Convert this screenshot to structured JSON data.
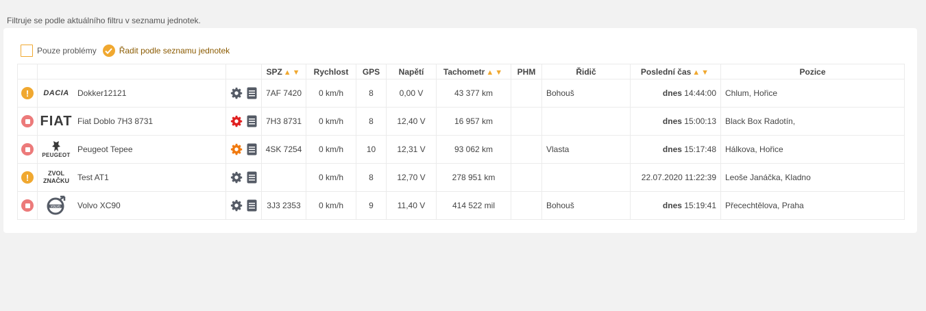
{
  "filter_note": "Filtruje se podle aktuálního filtru v seznamu jednotek.",
  "options": {
    "only_problems": "Pouze problémy",
    "sort_by_list": "Řadit podle seznamu jednotek"
  },
  "columns": {
    "spz": "SPZ",
    "speed": "Rychlost",
    "gps": "GPS",
    "voltage": "Napětí",
    "tachometer": "Tachometr",
    "phm": "PHM",
    "driver": "Řidič",
    "last_time": "Poslední čas",
    "position": "Pozice"
  },
  "colors": {
    "accent": "#f0a830",
    "stop": "#ec7a7a",
    "gear_default": "#555b66",
    "gear_red": "#e02020",
    "gear_orange": "#f07a10",
    "gps_green": "#2a8a2a"
  },
  "rows": [
    {
      "status": "warning-icon",
      "brand": "DACIA",
      "name": "Dokker12121",
      "gear": "default",
      "spz": "7AF 7420",
      "speed": "0 km/h",
      "gps": "8",
      "voltage": "0,00 V",
      "tachometer": "43 377 km",
      "phm": "",
      "driver": "Bohouš",
      "time_day": "dnes",
      "time": "14:44:00",
      "position": "Chlum, Hořice"
    },
    {
      "status": "stop-icon",
      "brand": "FIAT",
      "name": "Fiat Doblo 7H3 8731",
      "gear": "red",
      "spz": "7H3 8731",
      "speed": "0 km/h",
      "gps": "8",
      "voltage": "12,40 V",
      "tachometer": "16 957 km",
      "phm": "",
      "driver": "",
      "time_day": "dnes",
      "time": "15:00:13",
      "position": "Black Box Radotín,"
    },
    {
      "status": "stop-icon",
      "brand": "PEUGEOT",
      "name": "Peugeot Tepee",
      "gear": "orange",
      "spz": "4SK 7254",
      "speed": "0 km/h",
      "gps": "10",
      "voltage": "12,31 V",
      "tachometer": "93 062 km",
      "phm": "",
      "driver": "Vlasta",
      "time_day": "dnes",
      "time": "15:17:48",
      "position": "Hálkova, Hořice"
    },
    {
      "status": "warning-icon",
      "brand_line1": "ZVOL",
      "brand_line2": "ZNAČKU",
      "name": "Test AT1",
      "gear": "default",
      "spz": "",
      "speed": "0 km/h",
      "gps": "8",
      "voltage": "12,70 V",
      "tachometer": "278 951 km",
      "phm": "",
      "driver": "",
      "time_day": "",
      "time": "22.07.2020 11:22:39",
      "position": "Leoše Janáčka, Kladno"
    },
    {
      "status": "stop-icon",
      "brand": "VOLVO",
      "name": "Volvo XC90",
      "gear": "default",
      "spz": "3J3 2353",
      "speed": "0 km/h",
      "gps": "9",
      "voltage": "11,40 V",
      "tachometer": "414 522 mil",
      "phm": "",
      "driver": "Bohouš",
      "time_day": "dnes",
      "time": "15:19:41",
      "position": "Přecechtělova, Praha"
    }
  ]
}
